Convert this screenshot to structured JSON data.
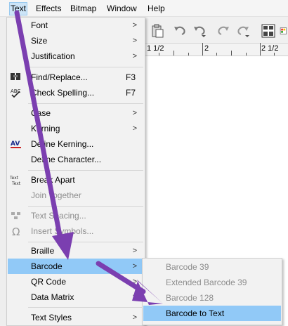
{
  "menubar": {
    "items": [
      {
        "label": "Text"
      },
      {
        "label": "Effects"
      },
      {
        "label": "Bitmap"
      },
      {
        "label": "Window"
      },
      {
        "label": "Help"
      }
    ]
  },
  "ruler": {
    "labels": [
      "1 1/2",
      "2",
      "2 1/2"
    ]
  },
  "text_menu": {
    "font": "Font",
    "size": "Size",
    "justification": "Justification",
    "find_replace": "Find/Replace...",
    "find_replace_shortcut": "F3",
    "check_spelling": "Check Spelling...",
    "check_spelling_shortcut": "F7",
    "case": "Case",
    "kerning": "Kerning",
    "define_kerning": "Define Kerning...",
    "define_character": "Define Character...",
    "break_apart": "Break Apart",
    "join_together": "Join Together",
    "text_spacing": "Text Spacing...",
    "insert_symbols": "Insert Symbols...",
    "braille": "Braille",
    "barcode": "Barcode",
    "qr_code": "QR Code",
    "data_matrix": "Data Matrix",
    "text_styles": "Text Styles"
  },
  "barcode_submenu": {
    "barcode39": "Barcode 39",
    "extended_barcode39": "Extended Barcode 39",
    "barcode128": "Barcode 128",
    "barcode_to_text": "Barcode to Text"
  },
  "colors": {
    "highlight": "#91c9f7",
    "annotation_arrow": "#7b3fb0",
    "disabled_text": "#8d8d8d"
  }
}
